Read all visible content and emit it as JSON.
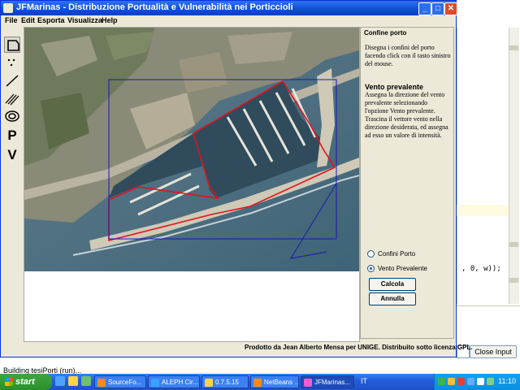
{
  "window": {
    "title": "JFMarinas - Distribuzione Portualità e Vulnerabilità nei Porticcioli",
    "menu": [
      "File",
      "Edit",
      "Esporta",
      "Visualizza",
      "Help"
    ]
  },
  "tools": [
    {
      "name": "polygon-tool-icon",
      "label": ""
    },
    {
      "name": "points-tool-icon",
      "label": ""
    },
    {
      "name": "line-tool-icon",
      "label": ""
    },
    {
      "name": "waves-tool-icon",
      "label": ""
    },
    {
      "name": "target-tool-icon",
      "label": ""
    },
    {
      "name": "p-tool",
      "label": "P"
    },
    {
      "name": "v-tool",
      "label": "V"
    }
  ],
  "panel": {
    "title": "Confine porto",
    "intro": "Disegna i confini del porto facendo click con il tasto sinistro del mouse.",
    "heading": "Vento prevalente",
    "body": "Assegna la direzione del vento prevalente selezionando l'opzione Vento prevalente. Trascina il vettore vento nella direzione desiderata, ed assegna ad esso un valore di intensità.",
    "radio_confini": "Confini Porto",
    "radio_vento": "Vento Prevalente",
    "selected": "Vento Prevalente",
    "btn_calcola": "Calcola",
    "btn_annulla": "Annulla"
  },
  "credits": "Prodotto da Jean Alberto Mensa per UNIGE. Distribuito sotto licenza GPL.",
  "background": {
    "code_line": ", 0, w));",
    "close_input": "Close Input",
    "status_left": "Building tesiPorti (run)...",
    "status_right": ""
  },
  "taskbar": {
    "start": "start",
    "tasks": [
      "SourceFo...",
      "ALEPH Cir...",
      "0.7.5.15",
      "NetBeans ...",
      "JFMarinas...",
      "IT"
    ],
    "clock": "11:10"
  },
  "colors": {
    "boundary": "#e0141e",
    "wind_vector": "#1a1aa6"
  }
}
